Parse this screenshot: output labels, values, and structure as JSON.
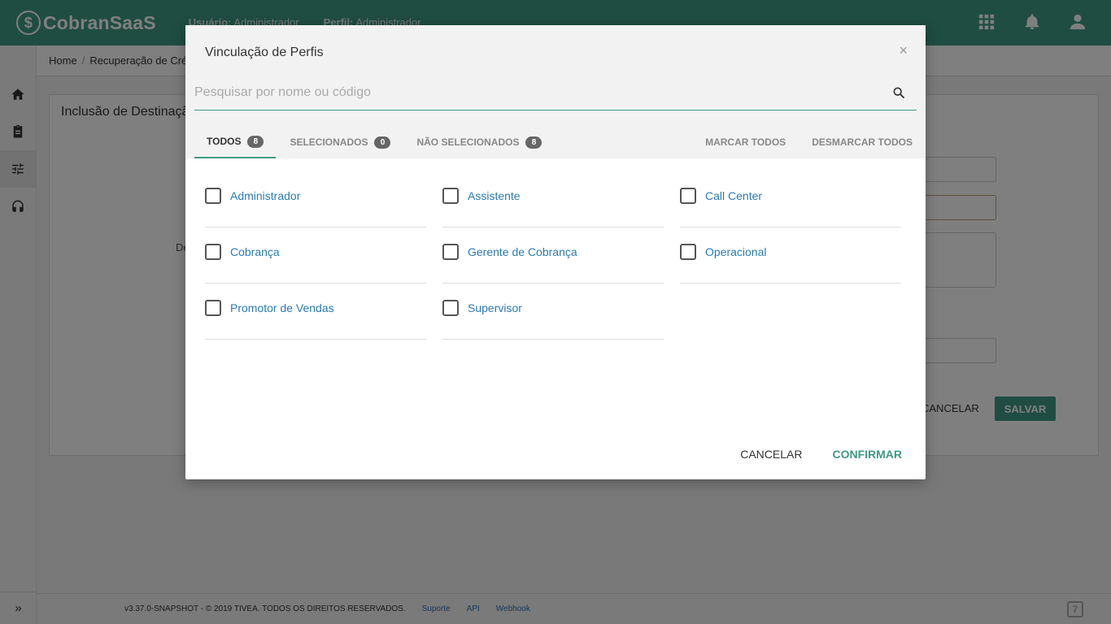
{
  "app": {
    "name": "CobranSaaS",
    "logo_glyph": "$"
  },
  "header": {
    "user_label": "Usuário:",
    "user_value": "Administrador",
    "profile_label": "Perfil:",
    "profile_value": "Administrador",
    "icons": [
      "apps-grid-icon",
      "bell-icon",
      "user-icon"
    ]
  },
  "sidebar": {
    "items": [
      "home-icon",
      "clipboard-icon",
      "sliders-icon",
      "headset-icon"
    ],
    "expand_glyph": "»"
  },
  "breadcrumb": {
    "home": "Home",
    "current": "Recuperação de Cré"
  },
  "background_card": {
    "title": "Inclusão de Destinaçã",
    "label_partial": "De",
    "cancel": "CANCELAR",
    "save": "SALVAR"
  },
  "footer": {
    "version": "v3.37.0-SNAPSHOT - © 2019 TIVEA. TODOS OS DIREITOS RESERVADOS.",
    "links": [
      "Suporte",
      "API",
      "Webhook"
    ],
    "logo_glyph": "7"
  },
  "modal": {
    "title": "Vinculação de Perfis",
    "close": "×",
    "search_placeholder": "Pesquisar por nome ou código",
    "tabs": [
      {
        "label": "TODOS",
        "count": "8"
      },
      {
        "label": "SELECIONADOS",
        "count": "0"
      },
      {
        "label": "NÃO SELECIONADOS",
        "count": "8"
      }
    ],
    "mark_all": "MARCAR TODOS",
    "unmark_all": "DESMARCAR TODOS",
    "profiles": [
      "Administrador",
      "Assistente",
      "Call Center",
      "Cobrança",
      "Gerente de Cobrança",
      "Operacional",
      "Promotor de Vendas",
      "Supervisor"
    ],
    "cancel": "CANCELAR",
    "confirm": "CONFIRMAR"
  }
}
